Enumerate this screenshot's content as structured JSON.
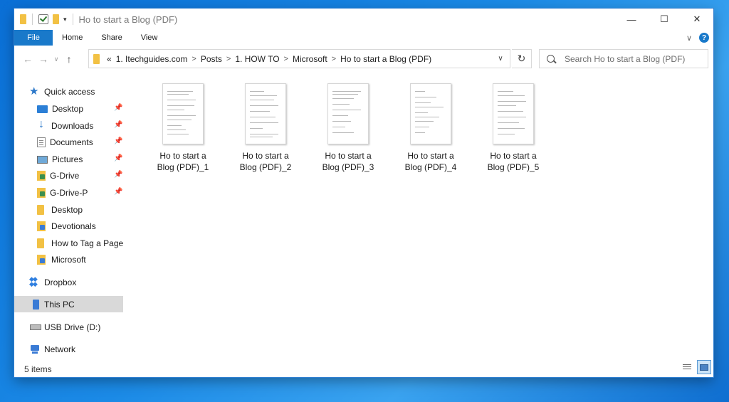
{
  "window": {
    "title": "Ho to start a Blog (PDF)"
  },
  "ribbon": {
    "file": "File",
    "home": "Home",
    "share": "Share",
    "view": "View"
  },
  "address": {
    "overflow": "«",
    "crumbs": [
      "1. Itechguides.com",
      "Posts",
      "1. HOW TO",
      "Microsoft",
      "Ho to start a Blog (PDF)"
    ]
  },
  "search": {
    "placeholder": "Search Ho to start a Blog (PDF)"
  },
  "sidebar": {
    "quick_access": "Quick access",
    "items": [
      {
        "label": "Desktop",
        "icon": "desktop-icon"
      },
      {
        "label": "Downloads",
        "icon": "downloads-icon"
      },
      {
        "label": "Documents",
        "icon": "documents-icon"
      },
      {
        "label": "Pictures",
        "icon": "pictures-icon"
      },
      {
        "label": "G-Drive",
        "icon": "gdrive-icon"
      },
      {
        "label": "G-Drive-P",
        "icon": "gdrive-icon"
      },
      {
        "label": "Desktop",
        "icon": "folder-icon"
      },
      {
        "label": "Devotionals",
        "icon": "folder-icon"
      },
      {
        "label": "How to Tag a Page o",
        "icon": "folder-icon"
      },
      {
        "label": "Microsoft",
        "icon": "folder-icon"
      }
    ],
    "dropbox": "Dropbox",
    "this_pc": "This PC",
    "usb": "USB Drive (D:)",
    "network": "Network"
  },
  "files": [
    {
      "line1": "Ho to start a",
      "line2": "Blog (PDF)_1"
    },
    {
      "line1": "Ho to start a",
      "line2": "Blog (PDF)_2"
    },
    {
      "line1": "Ho to start a",
      "line2": "Blog (PDF)_3"
    },
    {
      "line1": "Ho to start a",
      "line2": "Blog (PDF)_4"
    },
    {
      "line1": "Ho to start a",
      "line2": "Blog (PDF)_5"
    }
  ],
  "status": {
    "count": "5 items"
  },
  "colors": {
    "accent": "#1979ca",
    "folder": "#f2c144",
    "selected_nav": "#d9d9d9"
  }
}
